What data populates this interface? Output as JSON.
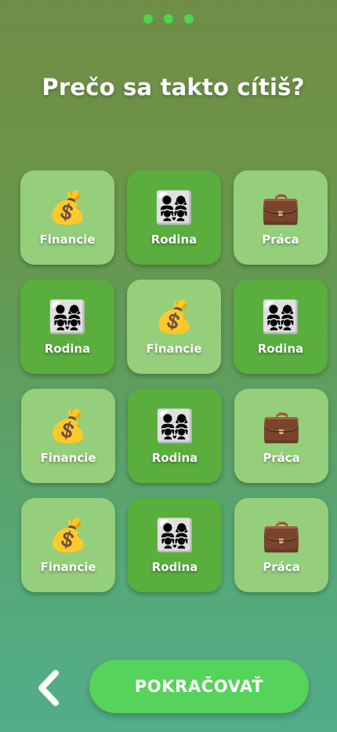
{
  "progress": {
    "dots": 3,
    "color": "#4bd64b"
  },
  "title": "Prečo sa takto cítiš?",
  "tiles": [
    {
      "emoji": "💰",
      "icon": "money-bag-icon",
      "label": "Financie",
      "shade": "light"
    },
    {
      "emoji": "👨‍👩‍👧‍👧",
      "icon": "family-icon",
      "label": "Rodina",
      "shade": "dark"
    },
    {
      "emoji": "💼",
      "icon": "briefcase-icon",
      "label": "Práca",
      "shade": "light"
    },
    {
      "emoji": "👨‍👩‍👧‍👧",
      "icon": "family-icon",
      "label": "Rodina",
      "shade": "dark"
    },
    {
      "emoji": "💰",
      "icon": "money-bag-icon",
      "label": "Financie",
      "shade": "light"
    },
    {
      "emoji": "👨‍👩‍👧‍👧",
      "icon": "family-icon",
      "label": "Rodina",
      "shade": "dark"
    },
    {
      "emoji": "💰",
      "icon": "money-bag-icon",
      "label": "Financie",
      "shade": "light"
    },
    {
      "emoji": "👨‍👩‍👧‍👧",
      "icon": "family-icon",
      "label": "Rodina",
      "shade": "dark"
    },
    {
      "emoji": "💼",
      "icon": "briefcase-icon",
      "label": "Práca",
      "shade": "light"
    },
    {
      "emoji": "💰",
      "icon": "money-bag-icon",
      "label": "Financie",
      "shade": "light"
    },
    {
      "emoji": "👨‍👩‍👧‍👧",
      "icon": "family-icon",
      "label": "Rodina",
      "shade": "dark"
    },
    {
      "emoji": "💼",
      "icon": "briefcase-icon",
      "label": "Práca",
      "shade": "light"
    }
  ],
  "colors": {
    "tile_light": "#95cf7c",
    "tile_dark": "#5aae3e",
    "button": "#56d35a"
  },
  "footer": {
    "back_icon": "chevron-left-icon",
    "continue_label": "POKRAČOVAŤ"
  }
}
